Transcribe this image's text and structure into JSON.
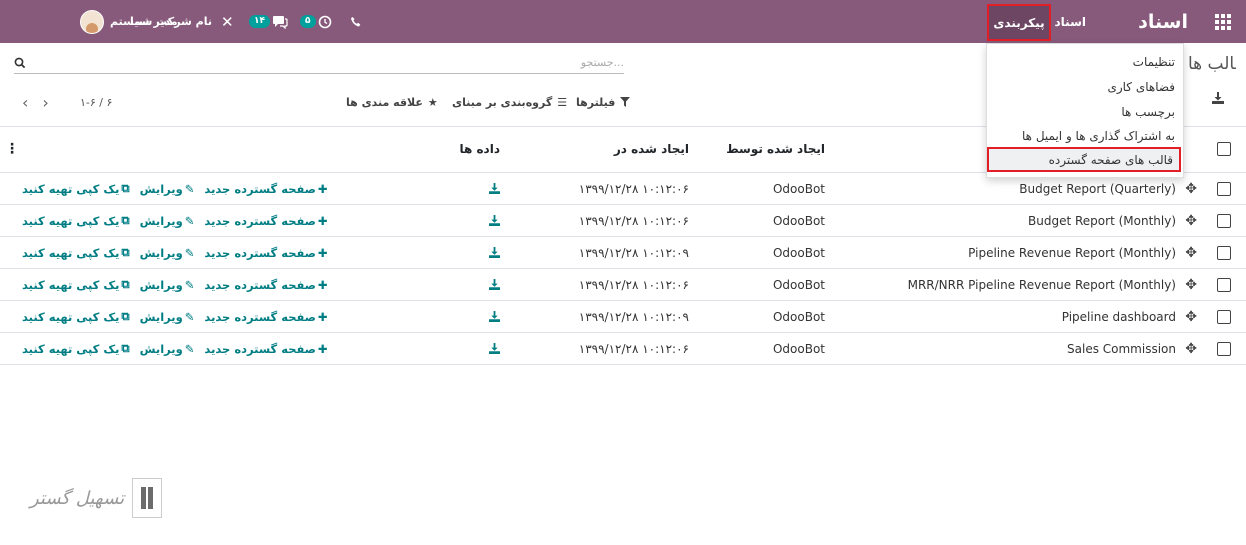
{
  "navbar": {
    "brand": "اسناد",
    "menu_documents": "اسناد",
    "menu_configuration": "پیکربندی",
    "company_name": "نام شرکت شما",
    "user_name": "مدیر سیستم",
    "messages_count": "۱۴",
    "activities_count": "۵",
    "close_symbol": "✕",
    "phone_symbol": "📞"
  },
  "page": {
    "title_peek": "قالب ها"
  },
  "search": {
    "placeholder": "جستجو...",
    "icon": "search-icon"
  },
  "controls": {
    "filters_label": "فیلترها",
    "group_by_label": "گروه‌بندی بر مبنای",
    "favorites_label": "علاقه مندی ها",
    "pager_value": "۱-۶ / ۶"
  },
  "table": {
    "headers": {
      "name": "",
      "created_by": "ایجاد شده توسط",
      "created_on": "ایجاد شده در",
      "data": "داده ها"
    },
    "actions": {
      "new_spreadsheet": "صفحه گسترده جدید",
      "edit": "ویرایش",
      "duplicate": "یک کپی تهیه کنید"
    },
    "rows": [
      {
        "name": "Budget Report (Quarterly)",
        "created_by": "OdooBot",
        "created_on": "۱۳۹۹/۱۲/۲۸ ۱۰:۱۲:۰۶"
      },
      {
        "name": "Budget Report (Monthly)",
        "created_by": "OdooBot",
        "created_on": "۱۳۹۹/۱۲/۲۸ ۱۰:۱۲:۰۶"
      },
      {
        "name": "Pipeline Revenue Report (Monthly)",
        "created_by": "OdooBot",
        "created_on": "۱۳۹۹/۱۲/۲۸ ۱۰:۱۲:۰۹"
      },
      {
        "name": "MRR/NRR Pipeline Revenue Report (Monthly)",
        "created_by": "OdooBot",
        "created_on": "۱۳۹۹/۱۲/۲۸ ۱۰:۱۲:۰۶"
      },
      {
        "name": "Pipeline dashboard",
        "created_by": "OdooBot",
        "created_on": "۱۳۹۹/۱۲/۲۸ ۱۰:۱۲:۰۹"
      },
      {
        "name": "Sales Commission",
        "created_by": "OdooBot",
        "created_on": "۱۳۹۹/۱۲/۲۸ ۱۰:۱۲:۰۶"
      }
    ]
  },
  "dropdown": {
    "items": [
      "تنظیمات",
      "فضاهای کاری",
      "برچسب ها",
      "به اشتراک گذاری ها و ایمیل ها"
    ],
    "active_item": "قالب های صفحه گسترده"
  },
  "watermark": {
    "text": "تسهیل گستر"
  },
  "colors": {
    "navbar": "#875a7b",
    "accent": "#017e84",
    "badge": "#00a09d",
    "highlight": "#e21f26"
  }
}
